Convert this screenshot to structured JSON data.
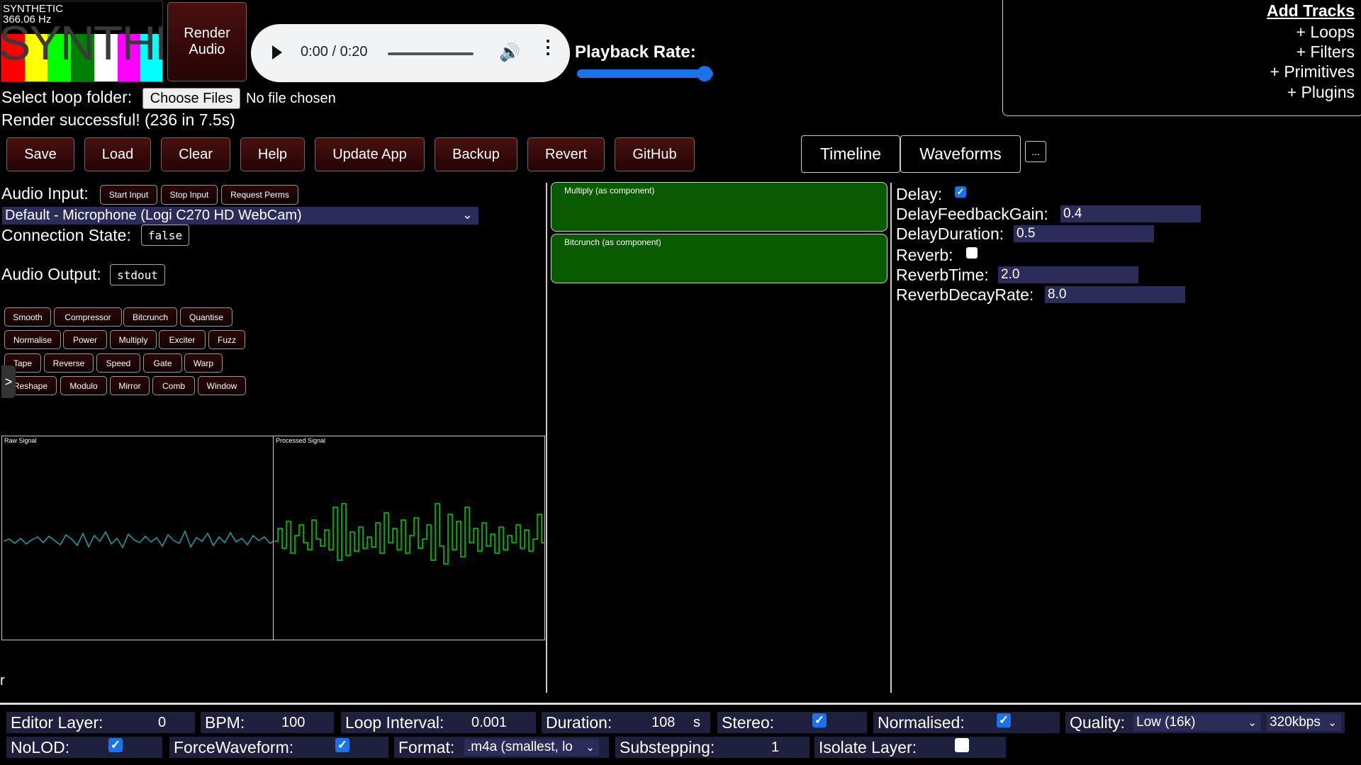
{
  "logo": {
    "title": "SYNTHETIC",
    "freq": "366.06 Hz",
    "bar_colors": [
      "#ff0000",
      "#ffff00",
      "#00ff00",
      "#008000",
      "#ffffff",
      "#ff00ff",
      "#00ffff"
    ]
  },
  "render_button": {
    "line1": "Render",
    "line2": "Audio"
  },
  "player": {
    "time": "0:00 / 0:20",
    "progress": 0
  },
  "playback_rate": {
    "label": "Playback Rate:"
  },
  "tracks_panel": {
    "title": "Add Tracks",
    "items": [
      "+ Loops",
      "+ Filters",
      "+ Primitives",
      "+ Plugins"
    ]
  },
  "loop_folder": {
    "label": "Select loop folder:",
    "button": "Choose Files",
    "status": "No file chosen"
  },
  "render_status": "Render successful! (236 in 7.5s)",
  "toolbar": [
    "Save",
    "Load",
    "Clear",
    "Help",
    "Update App",
    "Backup",
    "Revert",
    "GitHub"
  ],
  "view_tabs": [
    "Timeline",
    "Waveforms"
  ],
  "more_tabs": "...",
  "audio_input": {
    "label": "Audio Input:",
    "buttons": [
      "Start Input",
      "Stop Input",
      "Request Perms"
    ],
    "device": "Default - Microphone (Logi C270 HD WebCam)"
  },
  "connection": {
    "label": "Connection State:",
    "value": "false"
  },
  "audio_output": {
    "label": "Audio Output:",
    "value": "stdout"
  },
  "effects": [
    [
      "Smooth",
      "Compressor",
      "Bitcrunch",
      "Quantise"
    ],
    [
      "Normalise",
      "Power",
      "Multiply",
      "Exciter",
      "Fuzz"
    ],
    [
      "Tape",
      "Reverse",
      "Speed",
      "Gate",
      "Warp"
    ],
    [
      "Reshape",
      "Modulo",
      "Mirror",
      "Comb",
      "Window"
    ]
  ],
  "side_toggle": ">",
  "scopes": {
    "raw": "Raw Signal",
    "processed": "Processed Signal"
  },
  "components": [
    "Multiply (as component)",
    "Bitcrunch (as component)"
  ],
  "params": {
    "delay": {
      "label": "Delay:",
      "checked": true
    },
    "delay_feedback": {
      "label": "DelayFeedbackGain:",
      "value": "0.4"
    },
    "delay_duration": {
      "label": "DelayDuration:",
      "value": "0.5"
    },
    "reverb": {
      "label": "Reverb:",
      "checked": false
    },
    "reverb_time": {
      "label": "ReverbTime:",
      "value": "2.0"
    },
    "reverb_decay": {
      "label": "ReverbDecayRate:",
      "value": "8.0"
    }
  },
  "stray_char": "r",
  "bottom": {
    "editor_layer": {
      "label": "Editor Layer:",
      "value": "0"
    },
    "bpm": {
      "label": "BPM:",
      "value": "100"
    },
    "loop_interval": {
      "label": "Loop Interval:",
      "value": "0.001"
    },
    "duration": {
      "label": "Duration:",
      "value": "108",
      "unit": "s"
    },
    "stereo": {
      "label": "Stereo:",
      "checked": true
    },
    "normalised": {
      "label": "Normalised:",
      "checked": true
    },
    "quality": {
      "label": "Quality:",
      "value": "Low (16k)",
      "bitrate": "320kbps"
    },
    "nolod": {
      "label": "NoLOD:",
      "checked": true
    },
    "force_waveform": {
      "label": "ForceWaveform:",
      "checked": true
    },
    "format": {
      "label": "Format:",
      "value": ".m4a (smallest, lo"
    },
    "substepping": {
      "label": "Substepping:",
      "value": "1"
    },
    "isolate_layer": {
      "label": "Isolate Layer:",
      "checked": false
    }
  },
  "colors": {
    "button_red": "#4a0f0f",
    "component_green": "#0a5a00",
    "raw_signal": "#1aa3a3",
    "processed_signal": "#00d400",
    "input_bg": "#2c2c5a",
    "accent": "#1a73e8"
  }
}
